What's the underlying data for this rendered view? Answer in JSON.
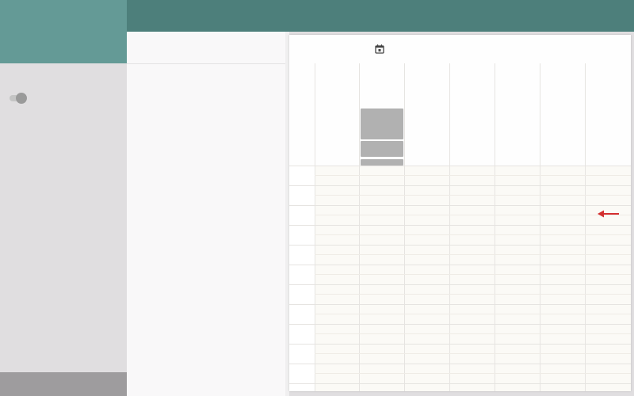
{
  "app": {
    "topbar_color": "#4d7f7b",
    "sidebar_header_color": "#649a96",
    "sidebar_color": "#e0dee0",
    "sidebar_footer_color": "#9e9c9e"
  },
  "sidebar": {
    "toggle": {
      "state": "off"
    }
  },
  "calendar": {
    "header_icon": "calendar-icon",
    "day_columns": 7,
    "time_rows": 12,
    "events": [
      {
        "day_index": 1,
        "color": "#b1b1b1"
      },
      {
        "day_index": 1,
        "color": "#b1b1b1"
      },
      {
        "day_index": 1,
        "color": "#b1b1b1"
      }
    ],
    "annotation": {
      "icon": "red-arrow-left-icon",
      "color": "#d32f2f"
    }
  }
}
